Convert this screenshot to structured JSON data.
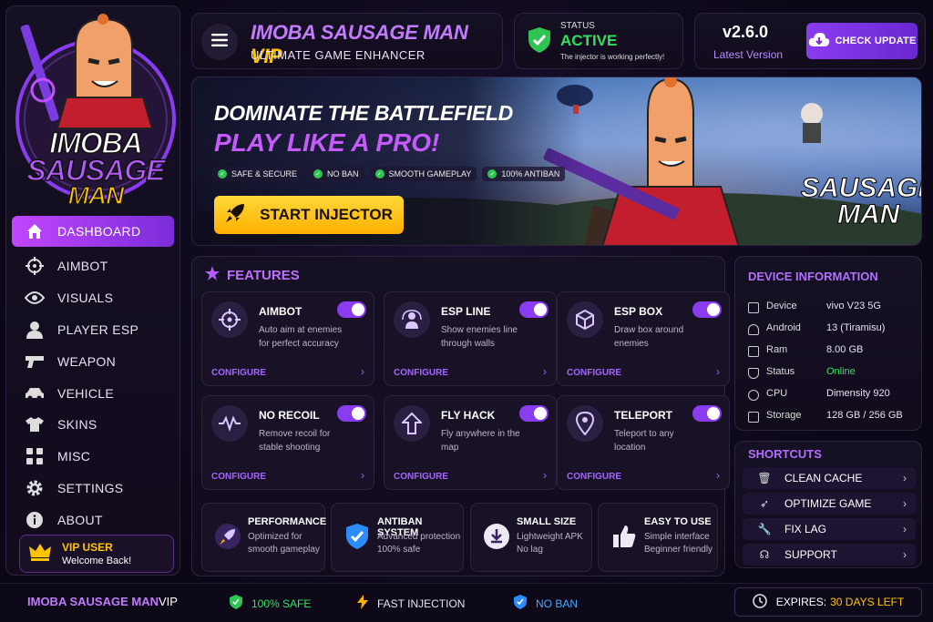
{
  "app": {
    "logo_line1": "IMOBA",
    "logo_line2": "SAUSAGE",
    "logo_line3": "MAN"
  },
  "sidebar": {
    "items": [
      {
        "label": "DASHBOARD",
        "icon": "home-icon"
      },
      {
        "label": "AIMBOT",
        "icon": "crosshair-icon"
      },
      {
        "label": "VISUALS",
        "icon": "eye-icon"
      },
      {
        "label": "PLAYER ESP",
        "icon": "user-icon"
      },
      {
        "label": "WEAPON",
        "icon": "gun-icon"
      },
      {
        "label": "VEHICLE",
        "icon": "car-icon"
      },
      {
        "label": "SKINS",
        "icon": "shirt-icon"
      },
      {
        "label": "MISC",
        "icon": "grid-icon"
      },
      {
        "label": "SETTINGS",
        "icon": "gear-icon"
      },
      {
        "label": "ABOUT",
        "icon": "info-icon"
      }
    ],
    "vip": {
      "title": "VIP USER",
      "sub": "Welcome Back!"
    }
  },
  "header": {
    "title_main": "IMOBA SAUSAGE MAN ",
    "title_vip": "VIP",
    "subtitle": "ULTIMATE GAME ENHANCER"
  },
  "status": {
    "label": "STATUS",
    "value": "ACTIVE",
    "message": "The injector is working perfectly!",
    "color": "#31e060"
  },
  "version": {
    "number": "v2.6.0",
    "label": "Latest Version",
    "button": "CHECK UPDATE"
  },
  "hero": {
    "line1": "DOMINATE THE BATTLEFIELD",
    "line2": "PLAY LIKE A PRO!",
    "tags": [
      "SAFE & SECURE",
      "NO BAN",
      "SMOOTH GAMEPLAY",
      "100% ANTIBAN"
    ],
    "button": "START INJECTOR",
    "game_logo_1": "SAUSAGE",
    "game_logo_2": "MAN"
  },
  "features": {
    "title": "FEATURES",
    "configure": "CONFIGURE",
    "cards": [
      {
        "name": "AIMBOT",
        "desc": "Auto aim at enemies for perfect accuracy",
        "icon": "crosshair-icon",
        "enabled": true
      },
      {
        "name": "ESP LINE",
        "desc": "Show enemies line through walls",
        "icon": "person-radar-icon",
        "enabled": true
      },
      {
        "name": "ESP BOX",
        "desc": "Draw box around enemies",
        "icon": "cube-icon",
        "enabled": true
      },
      {
        "name": "NO RECOIL",
        "desc": "Remove recoil for stable shooting",
        "icon": "wave-icon",
        "enabled": true
      },
      {
        "name": "FLY HACK",
        "desc": "Fly anywhere in the map",
        "icon": "arrow-up-icon",
        "enabled": true
      },
      {
        "name": "TELEPORT",
        "desc": "Teleport to any location",
        "icon": "location-pin-icon",
        "enabled": true
      }
    ],
    "bottom": [
      {
        "name": "PERFORMANCE",
        "desc1": "Optimized for",
        "desc2": "smooth gameplay",
        "icon": "rocket-icon"
      },
      {
        "name": "ANTIBAN SYSTEM",
        "desc1": "Advanced protection",
        "desc2": "100% safe",
        "icon": "shield-check-icon"
      },
      {
        "name": "SMALL SIZE",
        "desc1": "Lightweight APK",
        "desc2": "No lag",
        "icon": "download-icon"
      },
      {
        "name": "EASY TO USE",
        "desc1": "Simple interface",
        "desc2": "Beginner friendly",
        "icon": "thumbs-up-icon"
      }
    ]
  },
  "device": {
    "title": "DEVICE INFORMATION",
    "rows": [
      {
        "k": "Device",
        "v": "vivo V23 5G"
      },
      {
        "k": "Android",
        "v": "13 (Tiramisu)"
      },
      {
        "k": "Ram",
        "v": "8.00 GB"
      },
      {
        "k": "Status",
        "v": "Online"
      },
      {
        "k": "CPU",
        "v": "Dimensity 920"
      },
      {
        "k": "Storage",
        "v": "128 GB / 256 GB"
      }
    ]
  },
  "shortcuts": {
    "title": "SHORTCUTS",
    "items": [
      {
        "label": "CLEAN CACHE",
        "icon": "trash-icon"
      },
      {
        "label": "OPTIMIZE GAME",
        "icon": "rocket-icon"
      },
      {
        "label": "FIX LAG",
        "icon": "wrench-icon"
      },
      {
        "label": "SUPPORT",
        "icon": "headset-icon"
      }
    ]
  },
  "footer": {
    "brand": "IMOBA SAUSAGE MAN ",
    "brand_vip": "VIP",
    "safe": "100% SAFE",
    "fast": "FAST INJECTION",
    "noban": "NO BAN",
    "expires_label": "EXPIRES:",
    "expires_value": "30 DAYS LEFT"
  }
}
